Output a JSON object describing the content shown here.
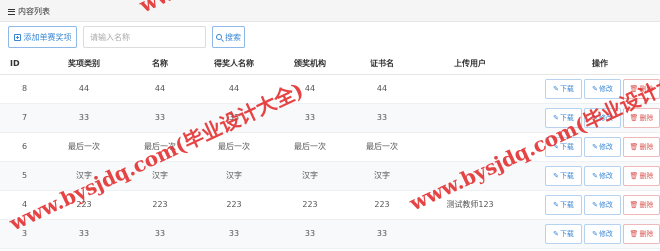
{
  "panel": {
    "title": "内容列表",
    "icon": "list-icon"
  },
  "toolbar": {
    "add_label": "添加单赛奖项",
    "search_placeholder": "请输入名称",
    "search_label": "搜索"
  },
  "table": {
    "headers": [
      "ID",
      "奖项类别",
      "名称",
      "得奖人名称",
      "颁奖机构",
      "证书名",
      "上传用户",
      "操作"
    ],
    "rows": [
      [
        "8",
        "44",
        "44",
        "44",
        "44",
        "44",
        ""
      ],
      [
        "7",
        "33",
        "33",
        "33",
        "33",
        "33",
        ""
      ],
      [
        "6",
        "最后一次",
        "最后一次",
        "最后一次",
        "最后一次",
        "最后一次",
        ""
      ],
      [
        "5",
        "汉字",
        "汉字",
        "汉字",
        "汉字",
        "汉字",
        ""
      ],
      [
        "4",
        "223",
        "223",
        "223",
        "223",
        "223",
        "测试教师123"
      ],
      [
        "3",
        "33",
        "33",
        "33",
        "33",
        "33",
        ""
      ]
    ],
    "actions": {
      "download": "下载",
      "edit": "修改",
      "delete": "删除"
    }
  },
  "watermarks": [
    "www.bysjdq.com(毕业设计大全)",
    "www.bysjdq.com(毕业设计大全)",
    "www.bysjdq.com(毕业设计大全)"
  ],
  "colors": {
    "primary": "#3a87d6",
    "danger": "#d9534f",
    "watermark": "#e22a2a"
  }
}
